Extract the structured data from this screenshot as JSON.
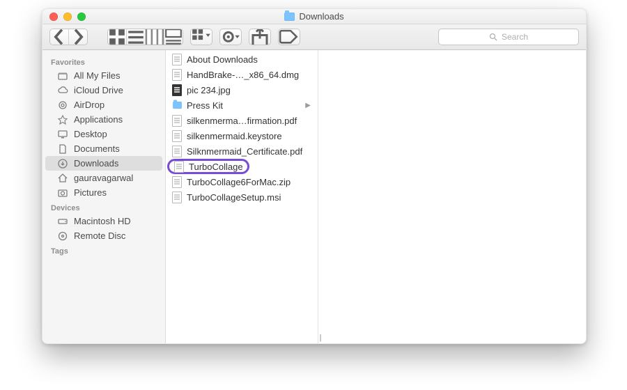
{
  "window": {
    "title": "Downloads"
  },
  "toolbar": {
    "search_placeholder": "Search"
  },
  "sidebar": {
    "sections": [
      {
        "header": "Favorites",
        "items": [
          {
            "icon": "all-my-files-icon",
            "label": "All My Files"
          },
          {
            "icon": "icloud-drive-icon",
            "label": "iCloud Drive"
          },
          {
            "icon": "airdrop-icon",
            "label": "AirDrop"
          },
          {
            "icon": "applications-icon",
            "label": "Applications"
          },
          {
            "icon": "desktop-icon",
            "label": "Desktop"
          },
          {
            "icon": "documents-icon",
            "label": "Documents"
          },
          {
            "icon": "downloads-icon",
            "label": "Downloads",
            "selected": true
          },
          {
            "icon": "home-icon",
            "label": "gauravagarwal"
          },
          {
            "icon": "pictures-icon",
            "label": "Pictures"
          }
        ]
      },
      {
        "header": "Devices",
        "items": [
          {
            "icon": "internal-disk-icon",
            "label": "Macintosh HD"
          },
          {
            "icon": "remote-disc-icon",
            "label": "Remote Disc"
          }
        ]
      },
      {
        "header": "Tags",
        "items": []
      }
    ]
  },
  "column": {
    "items": [
      {
        "kind": "txt",
        "label": "About Downloads"
      },
      {
        "kind": "dmg",
        "label": "HandBrake-…_x86_64.dmg"
      },
      {
        "kind": "jpg",
        "label": "pic 234.jpg"
      },
      {
        "kind": "folder",
        "label": "Press Kit",
        "has_children": true
      },
      {
        "kind": "pdf",
        "label": "silkenmerma…firmation.pdf"
      },
      {
        "kind": "key",
        "label": "silkenmermaid.keystore"
      },
      {
        "kind": "pdf",
        "label": "Silknmermaid_Certificate.pdf"
      },
      {
        "kind": "app",
        "label": "TurboCollage",
        "circled": true
      },
      {
        "kind": "zip",
        "label": "TurboCollage6ForMac.zip"
      },
      {
        "kind": "msi",
        "label": "TurboCollageSetup.msi"
      }
    ]
  }
}
